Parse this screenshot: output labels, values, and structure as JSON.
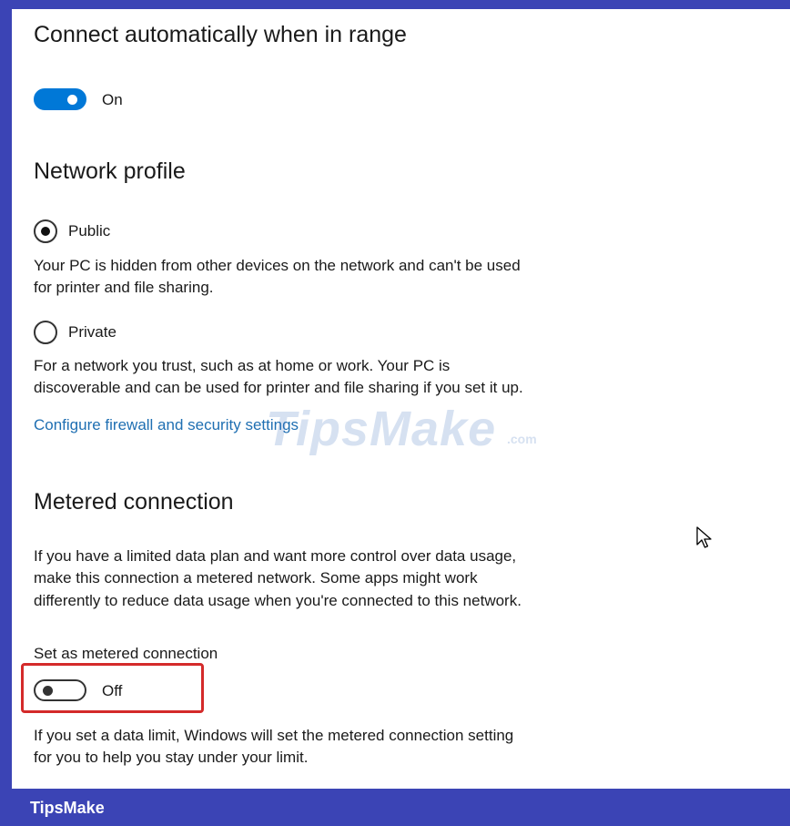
{
  "connect_section": {
    "heading": "Connect automatically when in range",
    "toggle_state": "On"
  },
  "network_profile": {
    "heading": "Network profile",
    "public": {
      "label": "Public",
      "selected": true,
      "description_line1": "Your PC is hidden from other devices on the network and can't be used",
      "description_line2": "for printer and file sharing."
    },
    "private": {
      "label": "Private",
      "selected": false,
      "description_line1": "For a network you trust, such as at home or work. Your PC is",
      "description_line2": "discoverable and can be used for printer and file sharing if you set it up."
    },
    "firewall_link": "Configure firewall and security settings"
  },
  "metered": {
    "heading": "Metered connection",
    "description_line1": "If you have a limited data plan and want more control over data usage,",
    "description_line2": "make this connection a metered network. Some apps might work",
    "description_line3": "differently to reduce data usage when you're connected to this network.",
    "toggle_title": "Set as metered connection",
    "toggle_state": "Off",
    "note_line1": "If you set a data limit, Windows will set the metered connection setting",
    "note_line2": "for you to help you stay under your limit."
  },
  "watermark": {
    "main": "TipsMake",
    "suffix": ".com"
  },
  "footer": {
    "brand": "TipsMake"
  },
  "colors": {
    "frame": "#3b44b5",
    "accent": "#0078d7",
    "link": "#1f6fb2",
    "highlight": "#d42a2a"
  }
}
